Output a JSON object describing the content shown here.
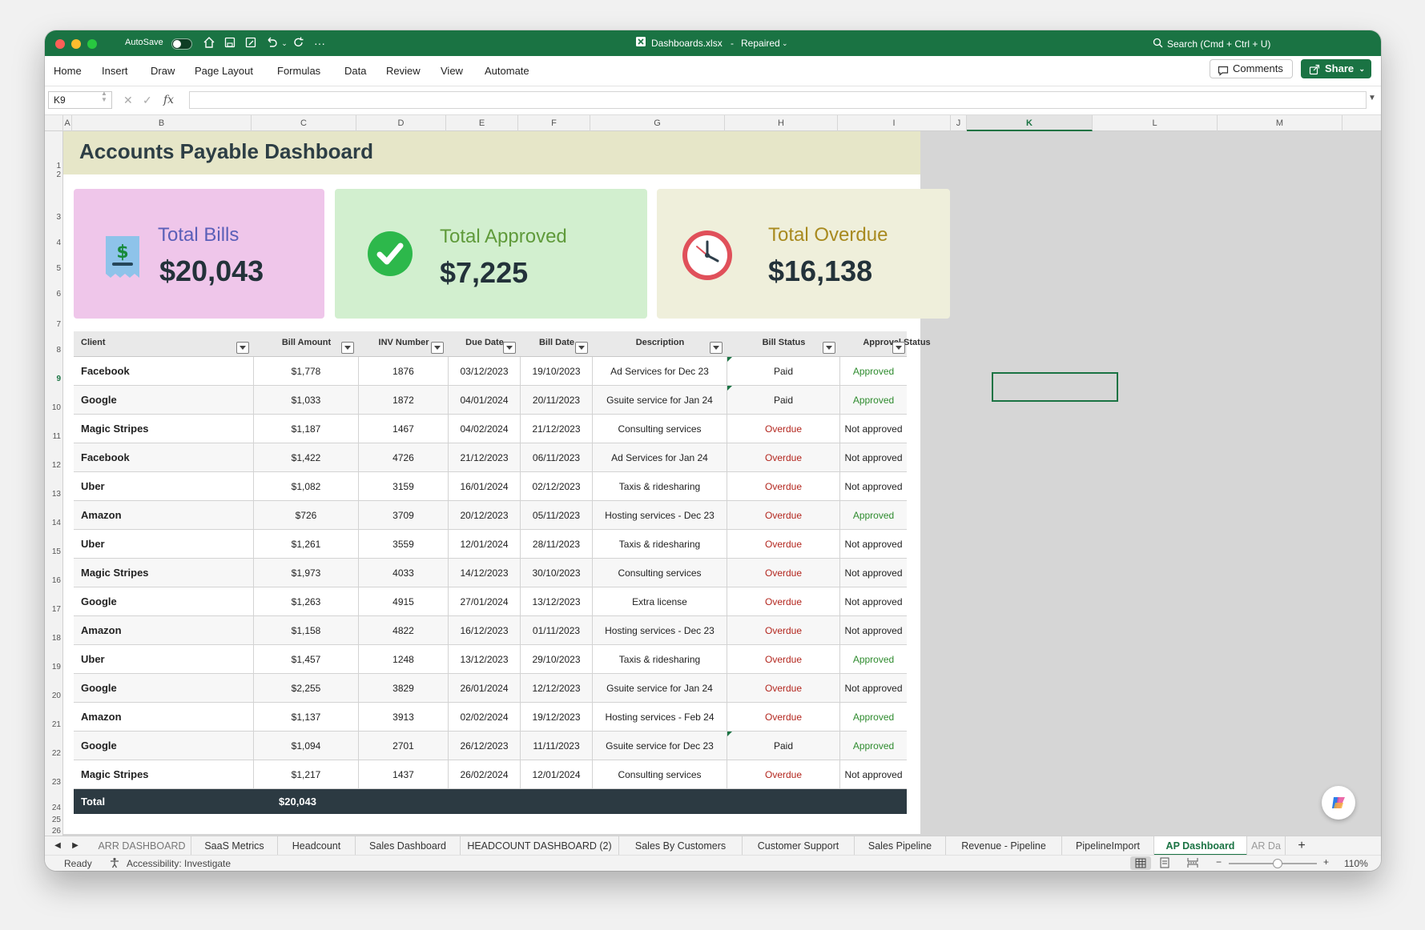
{
  "titlebar": {
    "autosave_label": "AutoSave",
    "filename": "Dashboards.xlsx",
    "separator": "-",
    "status": "Repaired",
    "search_placeholder": "Search (Cmd + Ctrl + U)"
  },
  "menu": [
    "Home",
    "Insert",
    "Draw",
    "Page Layout",
    "Formulas",
    "Data",
    "Review",
    "View",
    "Automate"
  ],
  "actions": {
    "comments": "Comments",
    "share": "Share"
  },
  "formula_bar": {
    "name_box": "K9",
    "fx": "fx",
    "formula": ""
  },
  "columns": [
    "A",
    "B",
    "C",
    "D",
    "E",
    "F",
    "G",
    "H",
    "I",
    "J",
    "K",
    "L",
    "M"
  ],
  "rows": [
    "1",
    "2",
    "3",
    "4",
    "5",
    "6",
    "7",
    "8",
    "9",
    "10",
    "11",
    "12",
    "13",
    "14",
    "15",
    "16",
    "17",
    "18",
    "19",
    "20",
    "21",
    "22",
    "23",
    "24",
    "25",
    "26"
  ],
  "dashboard": {
    "title": "Accounts Payable Dashboard",
    "cards": [
      {
        "title": "Total Bills",
        "value": "$20,043",
        "bg": "#efc6ea",
        "title_color": "#5a5fb8"
      },
      {
        "title": "Total Approved",
        "value": "$7,225",
        "bg": "#d2efcf",
        "title_color": "#5f9a3a"
      },
      {
        "title": "Total Overdue",
        "value": "$16,138",
        "bg": "#efefdb",
        "title_color": "#a88a1f"
      }
    ],
    "table": {
      "headers": [
        "Client",
        "Bill Amount",
        "INV Number",
        "Due Date",
        "Bill Date",
        "Description",
        "Bill Status",
        "Approval Status"
      ],
      "rows": [
        [
          "Facebook",
          "$1,778",
          "1876",
          "03/12/2023",
          "19/10/2023",
          "Ad Services for Dec 23",
          "Paid",
          "Approved"
        ],
        [
          "Google",
          "$1,033",
          "1872",
          "04/01/2024",
          "20/11/2023",
          "Gsuite service for Jan 24",
          "Paid",
          "Approved"
        ],
        [
          "Magic Stripes",
          "$1,187",
          "1467",
          "04/02/2024",
          "21/12/2023",
          "Consulting services",
          "Overdue",
          "Not approved"
        ],
        [
          "Facebook",
          "$1,422",
          "4726",
          "21/12/2023",
          "06/11/2023",
          "Ad Services for Jan 24",
          "Overdue",
          "Not approved"
        ],
        [
          "Uber",
          "$1,082",
          "3159",
          "16/01/2024",
          "02/12/2023",
          "Taxis & ridesharing",
          "Overdue",
          "Not approved"
        ],
        [
          "Amazon",
          "$726",
          "3709",
          "20/12/2023",
          "05/11/2023",
          "Hosting services - Dec 23",
          "Overdue",
          "Approved"
        ],
        [
          "Uber",
          "$1,261",
          "3559",
          "12/01/2024",
          "28/11/2023",
          "Taxis & ridesharing",
          "Overdue",
          "Not approved"
        ],
        [
          "Magic Stripes",
          "$1,973",
          "4033",
          "14/12/2023",
          "30/10/2023",
          "Consulting services",
          "Overdue",
          "Not approved"
        ],
        [
          "Google",
          "$1,263",
          "4915",
          "27/01/2024",
          "13/12/2023",
          "Extra license",
          "Overdue",
          "Not approved"
        ],
        [
          "Amazon",
          "$1,158",
          "4822",
          "16/12/2023",
          "01/11/2023",
          "Hosting services - Dec 23",
          "Overdue",
          "Not approved"
        ],
        [
          "Uber",
          "$1,457",
          "1248",
          "13/12/2023",
          "29/10/2023",
          "Taxis & ridesharing",
          "Overdue",
          "Approved"
        ],
        [
          "Google",
          "$2,255",
          "3829",
          "26/01/2024",
          "12/12/2023",
          "Gsuite service for Jan 24",
          "Overdue",
          "Not approved"
        ],
        [
          "Amazon",
          "$1,137",
          "3913",
          "02/02/2024",
          "19/12/2023",
          "Hosting services - Feb 24",
          "Overdue",
          "Approved"
        ],
        [
          "Google",
          "$1,094",
          "2701",
          "26/12/2023",
          "11/11/2023",
          "Gsuite service for Dec 23",
          "Paid",
          "Approved"
        ],
        [
          "Magic Stripes",
          "$1,217",
          "1437",
          "26/02/2024",
          "12/01/2024",
          "Consulting services",
          "Overdue",
          "Not approved"
        ]
      ],
      "total_label": "Total",
      "total_value": "$20,043"
    }
  },
  "sheet_tabs": [
    "ARR DASHBOARD",
    "SaaS Metrics",
    "Headcount",
    "Sales Dashboard",
    "HEADCOUNT DASHBOARD (2)",
    "Sales By Customers",
    "Customer Support",
    "Sales Pipeline",
    "Revenue - Pipeline",
    "PipelineImport",
    "AP Dashboard",
    "AR Da"
  ],
  "active_sheet": "AP Dashboard",
  "status": {
    "ready": "Ready",
    "accessibility": "Accessibility: Investigate",
    "zoom": "110%"
  },
  "colors": {
    "excel_green": "#1a7343",
    "overdue_red": "#b3261e",
    "approved_green": "#2e8b2e",
    "total_row_bg": "#2c3a42"
  }
}
